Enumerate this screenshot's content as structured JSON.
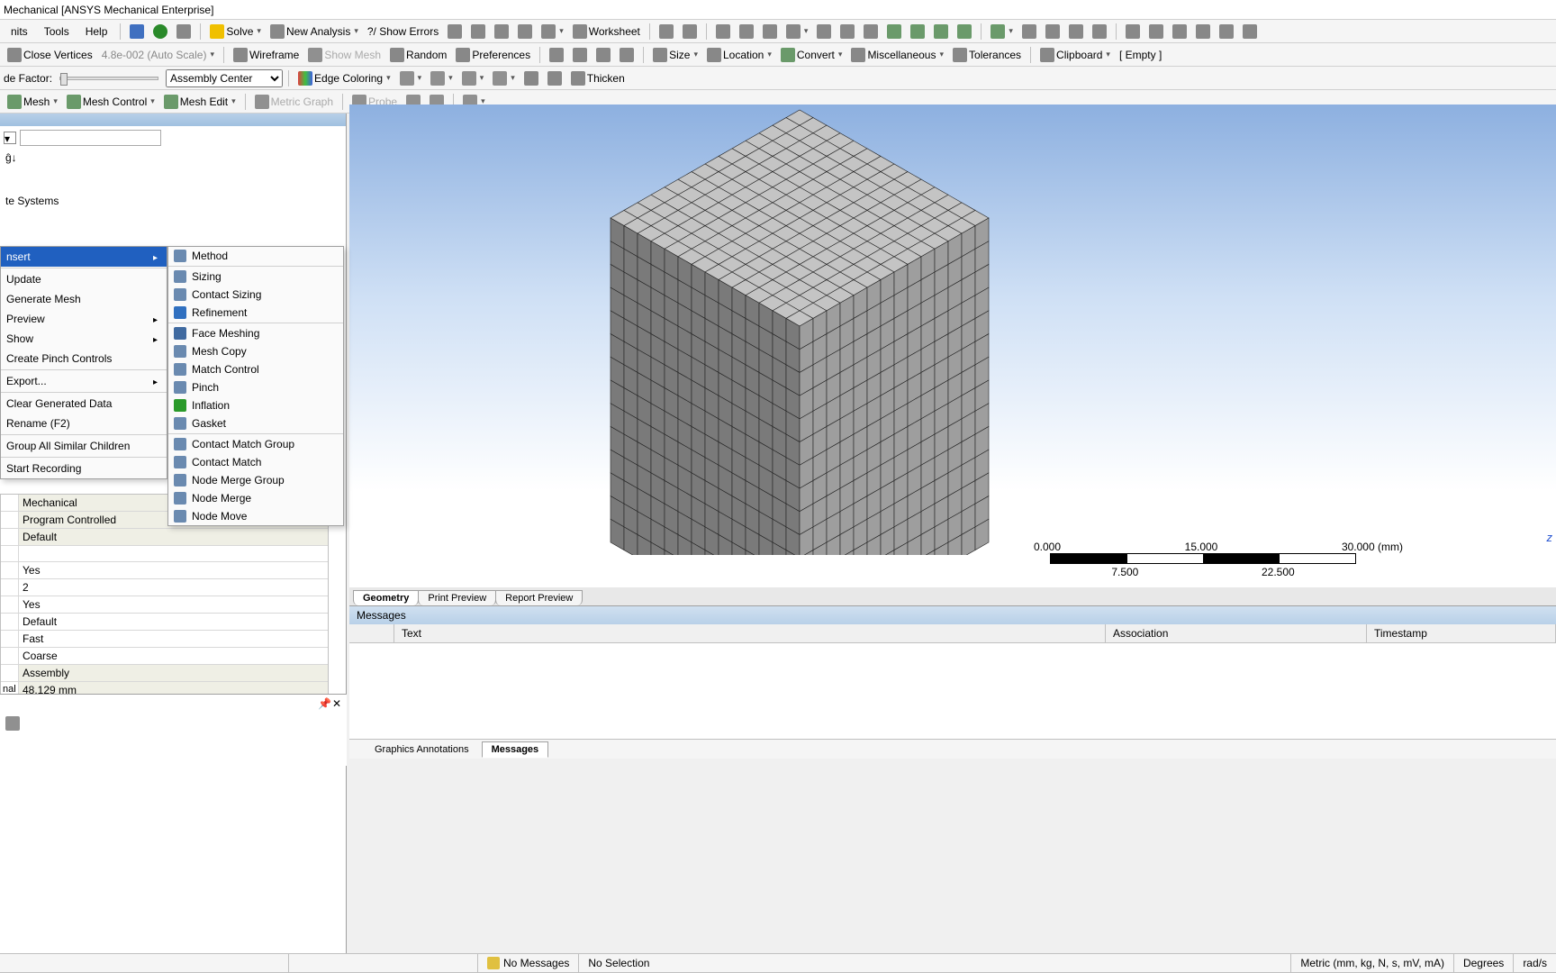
{
  "title": "Mechanical [ANSYS Mechanical Enterprise]",
  "menubar": {
    "units": "nits",
    "tools": "Tools",
    "help": "Help",
    "solve": "Solve",
    "new_analysis": "New Analysis",
    "show_errors": "?/ Show Errors",
    "worksheet": "Worksheet"
  },
  "tb2": {
    "close_vertices": "Close Vertices",
    "scale_val": "4.8e-002 (Auto Scale)",
    "wireframe": "Wireframe",
    "show_mesh": "Show Mesh",
    "random": "Random",
    "preferences": "Preferences",
    "size": "Size",
    "location": "Location",
    "convert": "Convert",
    "misc": "Miscellaneous",
    "tolerances": "Tolerances",
    "clipboard": "Clipboard",
    "empty": "[ Empty ]"
  },
  "tb3": {
    "node_factor": "de Factor:",
    "assembly_center": "Assembly Center",
    "edge_coloring": "Edge Coloring",
    "thicken": "Thicken"
  },
  "tb4": {
    "mesh": "Mesh",
    "mesh_control": "Mesh Control",
    "mesh_edit": "Mesh Edit",
    "metric_graph": "Metric Graph",
    "probe": "Probe"
  },
  "tree": {
    "systems": "te Systems"
  },
  "ctx": {
    "insert": "nsert",
    "update": "Update",
    "generate": "Generate Mesh",
    "preview": "Preview",
    "show": "Show",
    "pinch": "Create Pinch Controls",
    "export": "Export...",
    "clear": "Clear Generated Data",
    "rename": "Rename (F2)",
    "group_all": "Group All Similar Children",
    "record": "Start Recording"
  },
  "submenu": {
    "method": "Method",
    "sizing": "Sizing",
    "contact_sizing": "Contact Sizing",
    "refinement": "Refinement",
    "face_meshing": "Face Meshing",
    "mesh_copy": "Mesh Copy",
    "match_control": "Match Control",
    "pinch": "Pinch",
    "inflation": "Inflation",
    "gasket": "Gasket",
    "cmg": "Contact Match Group",
    "cm": "Contact Match",
    "nmg": "Node Merge Group",
    "nm": "Node Merge",
    "nmove": "Node Move"
  },
  "details": {
    "r0": "Mechanical",
    "r1": "Program Controlled",
    "r2": "Default",
    "r3": "Yes",
    "r4": "2",
    "r5": "Yes",
    "r6": "Default",
    "r7": "Fast",
    "r8": "Coarse",
    "r9": "Assembly",
    "r10_lbl": "nal",
    "r10": "48.129 mm"
  },
  "scale": {
    "t0": "0.000",
    "t1": "15.000",
    "t2": "30.000 (mm)",
    "s0": "7.500",
    "s1": "22.500"
  },
  "triad": "z",
  "viewtabs": {
    "geom": "Geometry",
    "print": "Print Preview",
    "report": "Report Preview"
  },
  "msgs": {
    "title": "Messages",
    "col_text": "Text",
    "col_assoc": "Association",
    "col_ts": "Timestamp"
  },
  "bottomtabs": {
    "ga": "Graphics Annotations",
    "msg": "Messages"
  },
  "status": {
    "no_msgs": "No Messages",
    "no_sel": "No Selection",
    "units": "Metric (mm, kg, N, s, mV, mA)",
    "deg": "Degrees",
    "rad": "rad/s"
  }
}
